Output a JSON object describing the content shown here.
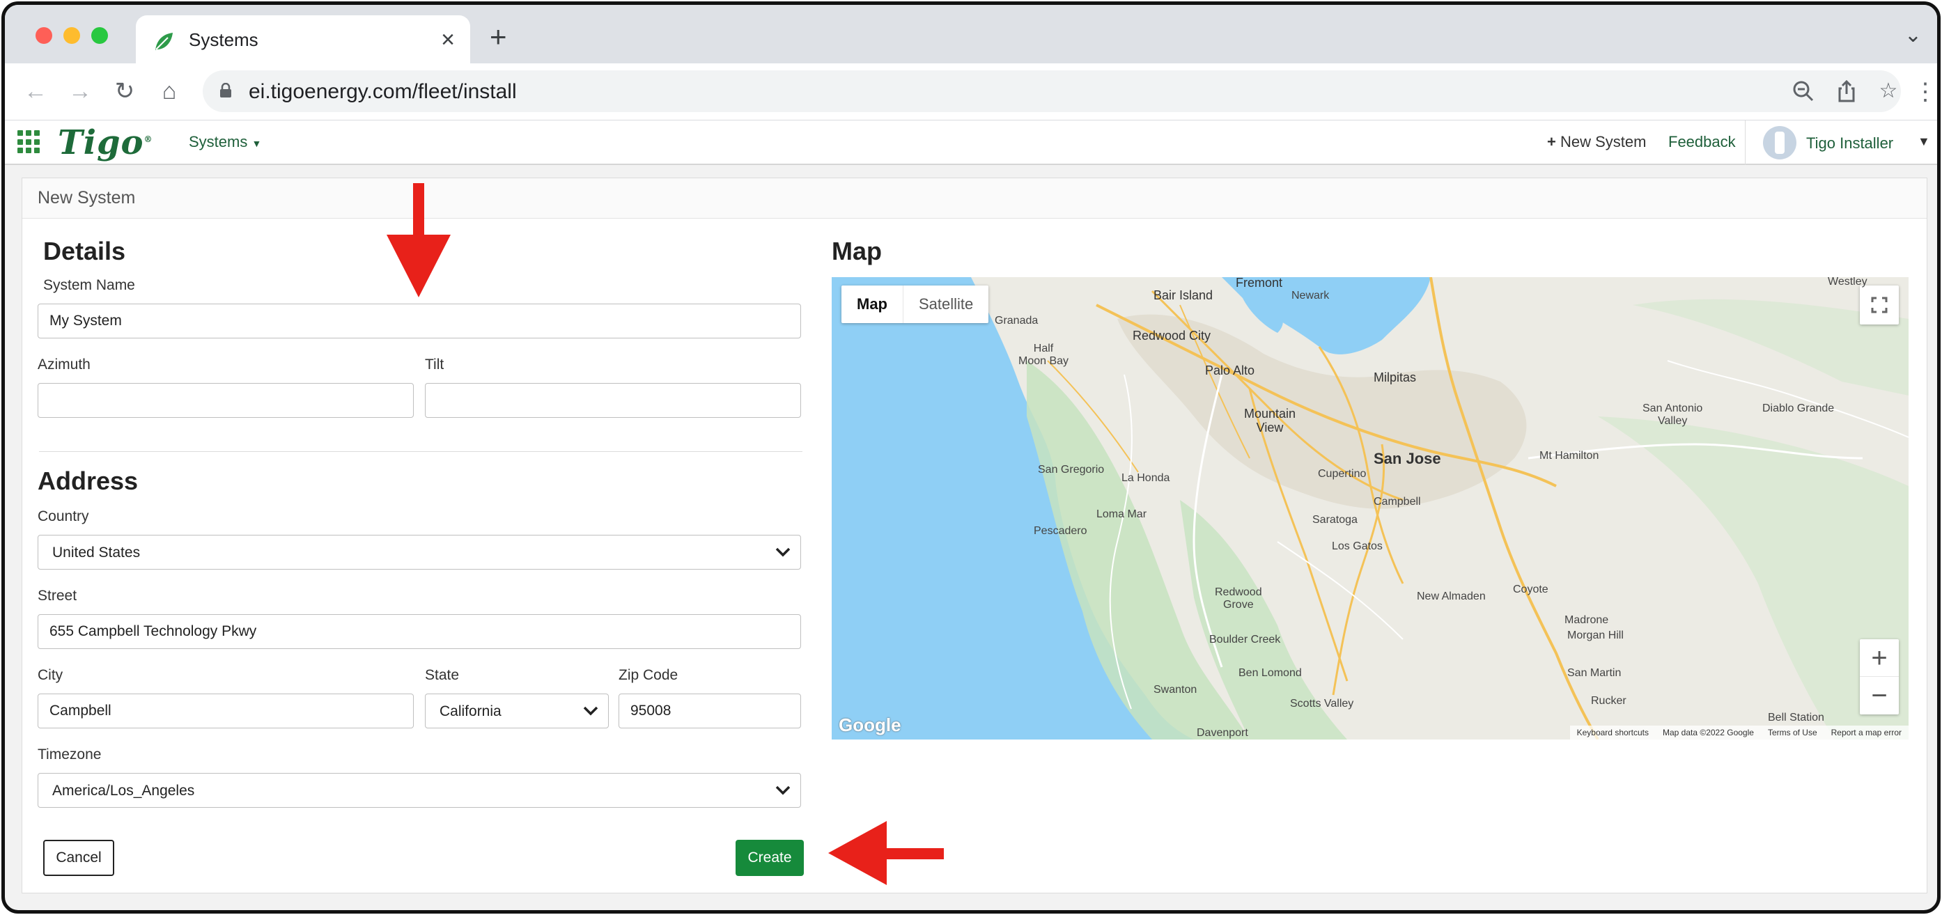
{
  "browser": {
    "tab_title": "Systems",
    "url": "ei.tigoenergy.com/fleet/install"
  },
  "app": {
    "logo": "Tigo",
    "logo_mark": "®",
    "systems_menu": "Systems",
    "new_system": "New System",
    "feedback": "Feedback",
    "user_name": "Tigo Installer"
  },
  "panel": {
    "title": "New System"
  },
  "details": {
    "heading": "Details",
    "system_name_label": "System Name",
    "system_name_value": "My System",
    "azimuth_label": "Azimuth",
    "azimuth_value": "",
    "tilt_label": "Tilt",
    "tilt_value": ""
  },
  "address": {
    "heading": "Address",
    "country_label": "Country",
    "country_value": "United States",
    "street_label": "Street",
    "street_value": "655 Campbell Technology Pkwy",
    "city_label": "City",
    "city_value": "Campbell",
    "state_label": "State",
    "state_value": "California",
    "zip_label": "Zip Code",
    "zip_value": "95008",
    "timezone_label": "Timezone",
    "timezone_value": "America/Los_Angeles"
  },
  "actions": {
    "cancel": "Cancel",
    "create": "Create"
  },
  "map": {
    "heading": "Map",
    "map_toggle": "Map",
    "satellite_toggle": "Satellite",
    "zoom_in": "+",
    "zoom_out": "−",
    "google_logo": "Google",
    "keyboard_shortcuts": "Keyboard shortcuts",
    "map_data": "Map data ©2022 Google",
    "terms": "Terms of Use",
    "report": "Report a map error",
    "places": {
      "fremont": "Fremont",
      "newark": "Newark",
      "bair_island": "Bair Island",
      "granada": "Granada",
      "half_moon_bay": "Half\nMoon Bay",
      "redwood_city": "Redwood City",
      "palo_alto": "Palo Alto",
      "milpitas": "Milpitas",
      "mountain_view": "Mountain\nView",
      "san_jose": "San Jose",
      "san_gregorio": "San Gregorio",
      "la_honda": "La Honda",
      "cupertino": "Cupertino",
      "campbell": "Campbell",
      "saratoga": "Saratoga",
      "los_gatos": "Los Gatos",
      "loma_mar": "Loma Mar",
      "pescadero": "Pescadero",
      "redwood_grove": "Redwood\nGrove",
      "boulder_creek": "Boulder Creek",
      "ben_lomond": "Ben Lomond",
      "scotts_valley": "Scotts Valley",
      "swanton": "Swanton",
      "davenport": "Davenport",
      "new_almaden": "New Almaden",
      "coyote": "Coyote",
      "madrone": "Madrone",
      "morgan_hill": "Morgan Hill",
      "san_martin": "San Martin",
      "rucker": "Rucker",
      "bell_station": "Bell Station",
      "mt_hamilton": "Mt Hamilton",
      "san_antonio_valley": "San Antonio\nValley",
      "diablo_grande": "Diablo Grande",
      "westley": "Westley"
    }
  },
  "colors": {
    "brand_green": "#168a3b",
    "annotation_red": "#e8211a",
    "water": "#8fcff5"
  }
}
